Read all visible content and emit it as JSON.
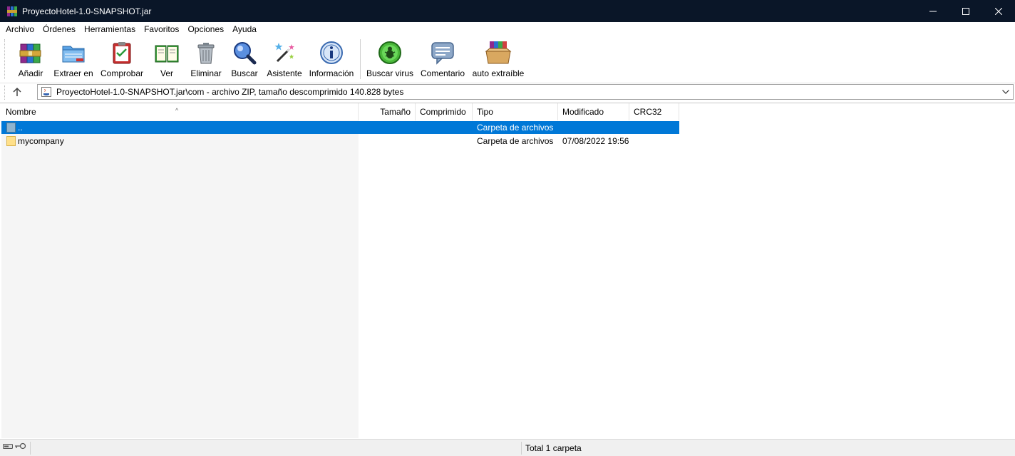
{
  "window": {
    "title": "ProyectoHotel-1.0-SNAPSHOT.jar"
  },
  "menu": [
    "Archivo",
    "Órdenes",
    "Herramientas",
    "Favoritos",
    "Opciones",
    "Ayuda"
  ],
  "toolbar": {
    "add": "Añadir",
    "extract": "Extraer en",
    "test": "Comprobar",
    "view": "Ver",
    "delete": "Eliminar",
    "find": "Buscar",
    "wizard": "Asistente",
    "info": "Información",
    "virus": "Buscar virus",
    "comment": "Comentario",
    "sfx": "auto extraíble"
  },
  "address": {
    "path": "ProyectoHotel-1.0-SNAPSHOT.jar\\com - archivo ZIP, tamaño descomprimido 140.828 bytes"
  },
  "columns": {
    "name": "Nombre",
    "size": "Tamaño",
    "packed": "Comprimido",
    "type": "Tipo",
    "modified": "Modificado",
    "crc": "CRC32"
  },
  "rows": [
    {
      "name": "..",
      "size": "",
      "packed": "",
      "type": "Carpeta de archivos",
      "modified": "",
      "crc": ""
    },
    {
      "name": "mycompany",
      "size": "",
      "packed": "",
      "type": "Carpeta de archivos",
      "modified": "07/08/2022 19:56",
      "crc": ""
    }
  ],
  "status": {
    "text": "Total 1 carpeta"
  },
  "colors": {
    "titlebar": "#0a1628",
    "selection": "#0078d7",
    "folder": "#ffe08a"
  }
}
